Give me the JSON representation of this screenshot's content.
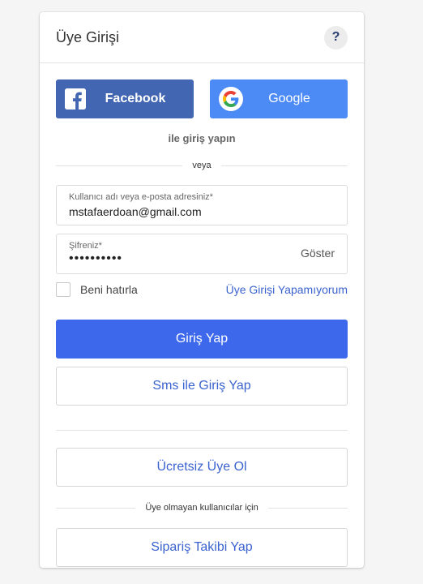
{
  "header": {
    "title": "Üye Girişi",
    "help_label": "?"
  },
  "social": {
    "facebook_label": "Facebook",
    "google_label": "Google",
    "with_text": "ile giriş yapın"
  },
  "divider_or": "veya",
  "username": {
    "label": "Kullanıcı adı veya e-posta adresiniz*",
    "value": "mstafaerdoan@gmail.com"
  },
  "password": {
    "label": "Şifreniz*",
    "value": "••••••••••",
    "show_label": "Göster"
  },
  "remember_label": "Beni hatırla",
  "forgot_label": "Üye Girişi Yapamıyorum",
  "login_button": "Giriş Yap",
  "sms_button": "Sms ile Giriş Yap",
  "register_button": "Ücretsiz Üye Ol",
  "non_member_divider": "Üye olmayan kullanıcılar için",
  "track_order_button": "Sipariş Takibi Yap",
  "colors": {
    "primary": "#3d68ec",
    "facebook": "#4266b2",
    "google": "#4c8bf5",
    "link": "#3b63cf"
  }
}
